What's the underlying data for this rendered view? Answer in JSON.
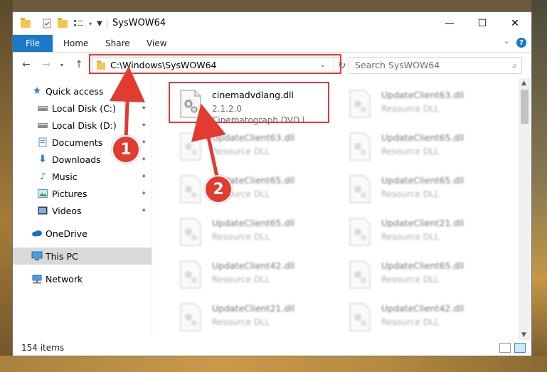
{
  "window": {
    "title": "SysWOW64",
    "controls": {
      "minimize": "—",
      "maximize": "☐",
      "close": "✕"
    }
  },
  "ribbon": {
    "tabs": [
      "File",
      "Home",
      "Share",
      "View"
    ],
    "help": "?"
  },
  "nav": {
    "address": "C:\\Windows\\SysWOW64",
    "search_placeholder": "Search SysWOW64"
  },
  "sidebar": {
    "items": [
      {
        "label": "Quick access",
        "icon": "star-icon",
        "pinned": false
      },
      {
        "label": "Local Disk (C:)",
        "icon": "drive-icon",
        "pinned": true
      },
      {
        "label": "Local Disk (D:)",
        "icon": "drive-icon",
        "pinned": true
      },
      {
        "label": "Documents",
        "icon": "documents-icon",
        "pinned": true
      },
      {
        "label": "Downloads",
        "icon": "download-icon",
        "pinned": true
      },
      {
        "label": "Music",
        "icon": "music-icon",
        "pinned": true
      },
      {
        "label": "Pictures",
        "icon": "pictures-icon",
        "pinned": true
      },
      {
        "label": "Videos",
        "icon": "videos-icon",
        "pinned": true
      },
      {
        "label": "OneDrive",
        "icon": "cloud-icon",
        "pinned": false
      },
      {
        "label": "This PC",
        "icon": "computer-icon",
        "pinned": false
      },
      {
        "label": "Network",
        "icon": "network-icon",
        "pinned": false
      }
    ]
  },
  "files": {
    "highlighted": {
      "name": "cinemadvdlang.dll",
      "version": "2.1.2.0",
      "description": "Cinematograph DVD l..."
    },
    "left_column": [
      {
        "name": "UpdateClient63.dll",
        "type": "Resource DLL"
      },
      {
        "name": "UpdateClient65.dll",
        "type": "Resource DLL"
      },
      {
        "name": "UpdateClient65.dll",
        "type": "Resource DLL"
      },
      {
        "name": "UpdateClient42.dll",
        "type": "Resource DLL"
      },
      {
        "name": "UpdateClient21.dll",
        "type": "Resource DLL"
      }
    ],
    "right_column": [
      {
        "name": "UpdateClient63.dll",
        "type": "Resource DLL"
      },
      {
        "name": "UpdateClient65.dll",
        "type": "Resource DLL"
      },
      {
        "name": "UpdateClient65.dll",
        "type": "Resource DLL"
      },
      {
        "name": "UpdateClient21.dll",
        "type": "Resource DLL"
      },
      {
        "name": "UpdateClient65.dll",
        "type": "Resource DLL"
      },
      {
        "name": "UpdateClient42.dll",
        "type": "Resource DLL"
      }
    ]
  },
  "status": {
    "item_count": "154 items"
  },
  "annotations": {
    "step1": "1",
    "step2": "2",
    "color": "#e23b2f"
  }
}
